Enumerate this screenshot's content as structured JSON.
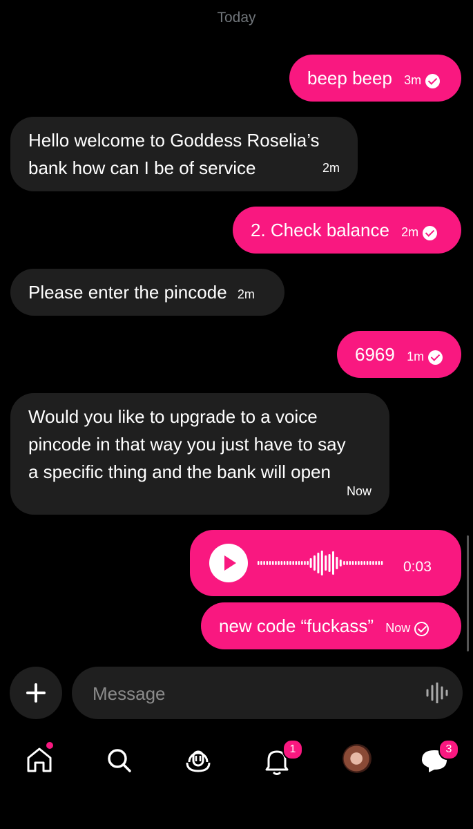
{
  "conversation": {
    "date_separator": "Today",
    "messages": [
      {
        "direction": "sent",
        "text": "beep beep",
        "time": "3m",
        "status": "read"
      },
      {
        "direction": "received",
        "text_lines": [
          "Hello welcome to Goddess Roselia’s",
          "bank how can I be of service"
        ],
        "time": "2m"
      },
      {
        "direction": "sent",
        "text": "2. Check balance",
        "time": "2m",
        "status": "read"
      },
      {
        "direction": "received",
        "text": "Please enter the pincode",
        "time": "2m"
      },
      {
        "direction": "sent",
        "text": "6969",
        "time": "1m",
        "status": "read"
      },
      {
        "direction": "received",
        "text_lines": [
          "Would you like to upgrade to a voice",
          "pincode in that way you just have to say",
          "a specific thing and the bank will open"
        ],
        "time": "Now"
      },
      {
        "direction": "sent",
        "type": "voice",
        "duration": "0:03"
      },
      {
        "direction": "sent",
        "text": "new code “fuckass”",
        "time": "Now",
        "status": "sent"
      }
    ]
  },
  "composer": {
    "placeholder": "Message"
  },
  "nav": {
    "items": [
      "home",
      "search",
      "grok",
      "notifications",
      "profile",
      "messages"
    ],
    "notifications_badge": "1",
    "messages_badge": "3"
  },
  "colors": {
    "accent": "#f91880",
    "bubble_received": "#1f1f1f",
    "background": "#000000"
  }
}
